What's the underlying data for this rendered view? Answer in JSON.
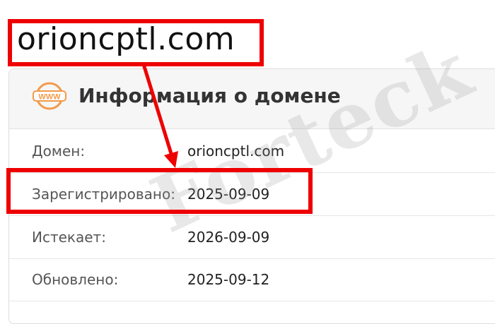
{
  "domain_heading": "orioncptl.com",
  "card": {
    "title": "Информация о домене",
    "icon_label": "WWW"
  },
  "rows": [
    {
      "label": "Домен:",
      "value": "orioncptl.com"
    },
    {
      "label": "Зарегистрировано:",
      "value": "2025-09-09"
    },
    {
      "label": "Истекает:",
      "value": "2026-09-09"
    },
    {
      "label": "Обновлено:",
      "value": "2025-09-12"
    }
  ],
  "watermark": "Forteck",
  "colors": {
    "highlight_red": "#ee0000",
    "icon_orange": "#f39a4a",
    "header_bg": "#f6f6f6"
  }
}
